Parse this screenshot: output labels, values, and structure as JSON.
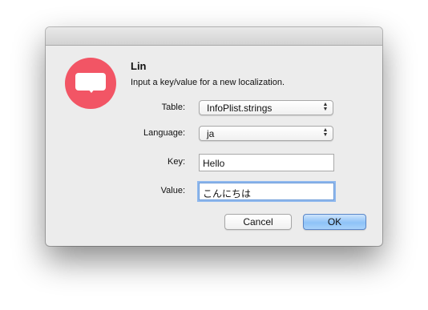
{
  "dialog": {
    "title": "Lin",
    "message": "Input a key/value for a new localization.",
    "icon": "speech-bubble-icon",
    "accent_color": "#f25565"
  },
  "form": {
    "table_label": "Table:",
    "table_value": "InfoPlist.strings",
    "language_label": "Language:",
    "language_value": "ja",
    "key_label": "Key:",
    "key_value": "Hello",
    "value_label": "Value:",
    "value_value": "こんにちは"
  },
  "buttons": {
    "cancel_label": "Cancel",
    "ok_label": "OK"
  }
}
